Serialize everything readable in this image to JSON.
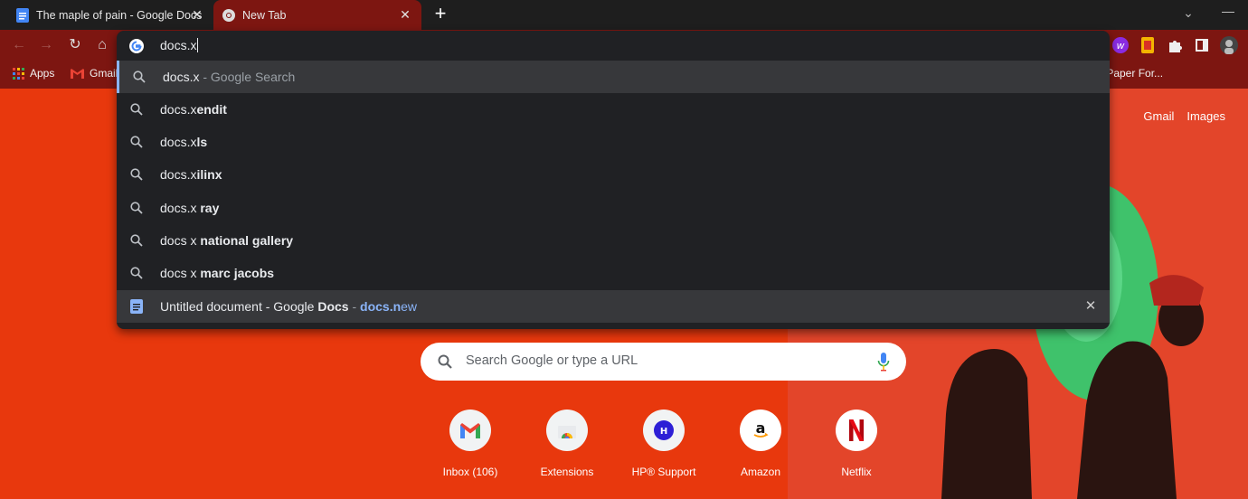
{
  "tabs": [
    {
      "title": "The maple of pain - Google Docs",
      "icon": "google-docs-icon",
      "active": false
    },
    {
      "title": "New Tab",
      "icon": "chrome-icon",
      "active": true
    }
  ],
  "toolbar": {
    "back_icon": "arrow-left-icon",
    "forward_icon": "arrow-right-icon",
    "reload_icon": "reload-icon",
    "home_icon": "home-icon"
  },
  "bookmarks": [
    {
      "label": "Apps",
      "icon": "apps-grid-icon"
    },
    {
      "label": "Gmail",
      "icon": "gmail-icon"
    },
    {
      "label": "y Paper For...",
      "icon": ""
    }
  ],
  "omnibox": {
    "input_value": "docs.x",
    "suggestions": [
      {
        "typed": "docs.x",
        "completion": "",
        "suffix": " - Google Search",
        "icon": "search-icon",
        "selected": true
      },
      {
        "typed": "docs.x",
        "completion": "endit",
        "suffix": "",
        "icon": "search-icon"
      },
      {
        "typed": "docs.x",
        "completion": "ls",
        "suffix": "",
        "icon": "search-icon"
      },
      {
        "typed": "docs.x",
        "completion": "ilinx",
        "suffix": "",
        "icon": "search-icon"
      },
      {
        "typed": "docs.x",
        "completion": " ray",
        "suffix": "",
        "icon": "search-icon"
      },
      {
        "typed": "docs x",
        "completion": " national gallery",
        "suffix": "",
        "icon": "search-icon"
      },
      {
        "typed": "docs x",
        "completion": " marc jacobs",
        "suffix": "",
        "icon": "search-icon"
      }
    ],
    "doc_suggestion": {
      "title_start": "Untitled document - Google ",
      "title_bold": "Docs",
      "separator": " - ",
      "url_bold": "docs.n",
      "url_rest": "ew",
      "icon": "google-docs-icon",
      "remove_label": "✕"
    }
  },
  "top_links": {
    "gmail": "Gmail",
    "images": "Images"
  },
  "search": {
    "placeholder": "Search Google or type a URL"
  },
  "shortcuts": [
    {
      "label": "Inbox (106)",
      "icon": "gmail-icon"
    },
    {
      "label": "Extensions",
      "icon": "chrome-web-store-icon"
    },
    {
      "label": "HP® Support",
      "icon": "hp-icon"
    },
    {
      "label": "Amazon",
      "icon": "amazon-icon"
    },
    {
      "label": "Netflix",
      "icon": "netflix-icon"
    }
  ],
  "colors": {
    "tab_active": "#7d1611",
    "background": "#e8380d",
    "omnibox_bg": "#202124",
    "accent_blue": "#8ab4f8"
  }
}
